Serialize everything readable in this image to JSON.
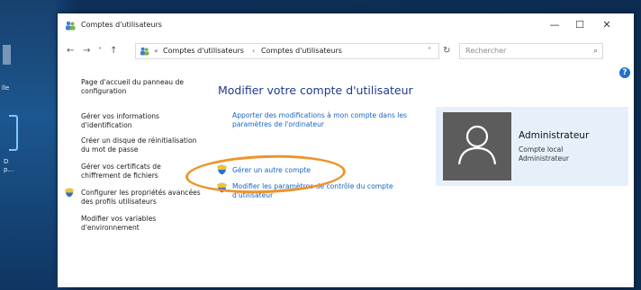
{
  "window": {
    "title": "Comptes d'utilisateurs",
    "minimize": "—",
    "maximize": "☐",
    "close": "✕"
  },
  "nav": {
    "back": "←",
    "forward": "→",
    "recent": "˅",
    "up": "↑",
    "breadcrumb": [
      "«",
      "Comptes d'utilisateurs",
      "Comptes d'utilisateurs"
    ],
    "separator": "›",
    "dropdown": "˅",
    "refresh": "↻",
    "search_placeholder": "Rechercher",
    "search_icon": "⌕"
  },
  "help": {
    "label": "?"
  },
  "left_pane": {
    "links": [
      {
        "text": "Page d'accueil du panneau de configuration",
        "shield": false
      },
      {
        "text": "Gérer vos informations d'identification",
        "shield": false
      },
      {
        "text": "Créer un disque de réinitialisation du mot de passe",
        "shield": false
      },
      {
        "text": "Gérer vos certificats de chiffrement de fichiers",
        "shield": false
      },
      {
        "text": "Configurer les propriétés avancées des profils utilisateurs",
        "shield": true
      },
      {
        "text": "Modifier vos variables d'environnement",
        "shield": false
      }
    ]
  },
  "main": {
    "title": "Modifier votre compte d'utilisateur",
    "links": [
      {
        "text": "Apporter des modifications à mon compte dans les paramètres de l'ordinateur",
        "shield": false
      },
      {
        "text": "Gérer un autre compte",
        "shield": true,
        "highlighted": true
      },
      {
        "text": "Modifier les paramètres de contrôle du compte d'utilisateur",
        "shield": true
      }
    ]
  },
  "account": {
    "name": "Administrateur",
    "type": "Compte local",
    "role": "Administrateur"
  },
  "desktop": {
    "labels": [
      "lle",
      "D",
      "p..."
    ]
  },
  "colors": {
    "link": "#1565c0",
    "title": "#1e3a8a",
    "highlight_oval": "#f0932b",
    "card_bg": "#e6f0fb",
    "avatar_bg": "#5c5c5c"
  }
}
